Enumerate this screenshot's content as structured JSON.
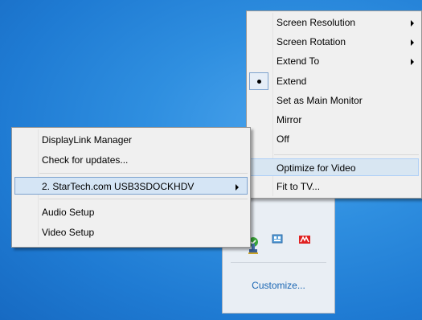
{
  "tray": {
    "customize_label": "Customize...",
    "icons": [
      "shield-check-icon",
      "display-settings-icon",
      "graphics-card-icon",
      "usb-device-icon"
    ]
  },
  "displaylink_menu": {
    "items": [
      {
        "label": "DisplayLink Manager"
      },
      {
        "label": "Check for updates..."
      },
      {
        "label": "2. StarTech.com USB3SDOCKHDV",
        "has_submenu": true,
        "highlighted": true
      },
      {
        "label": "Audio Setup"
      },
      {
        "label": "Video Setup"
      }
    ]
  },
  "display_submenu": {
    "items": [
      {
        "label": "Screen Resolution",
        "has_submenu": true
      },
      {
        "label": "Screen Rotation",
        "has_submenu": true
      },
      {
        "label": "Extend To",
        "has_submenu": true
      },
      {
        "label": "Extend",
        "checked": true
      },
      {
        "label": "Set as Main Monitor"
      },
      {
        "label": "Mirror"
      },
      {
        "label": "Off"
      },
      {
        "label": "Optimize for Video",
        "highlighted": true
      },
      {
        "label": "Fit to TV..."
      }
    ]
  },
  "colors": {
    "menu_bg": "#f0f0f0",
    "highlight_bg": "#d8e6f2",
    "desktop_blue": "#2f8fe0",
    "link_blue": "#1a66b3"
  }
}
